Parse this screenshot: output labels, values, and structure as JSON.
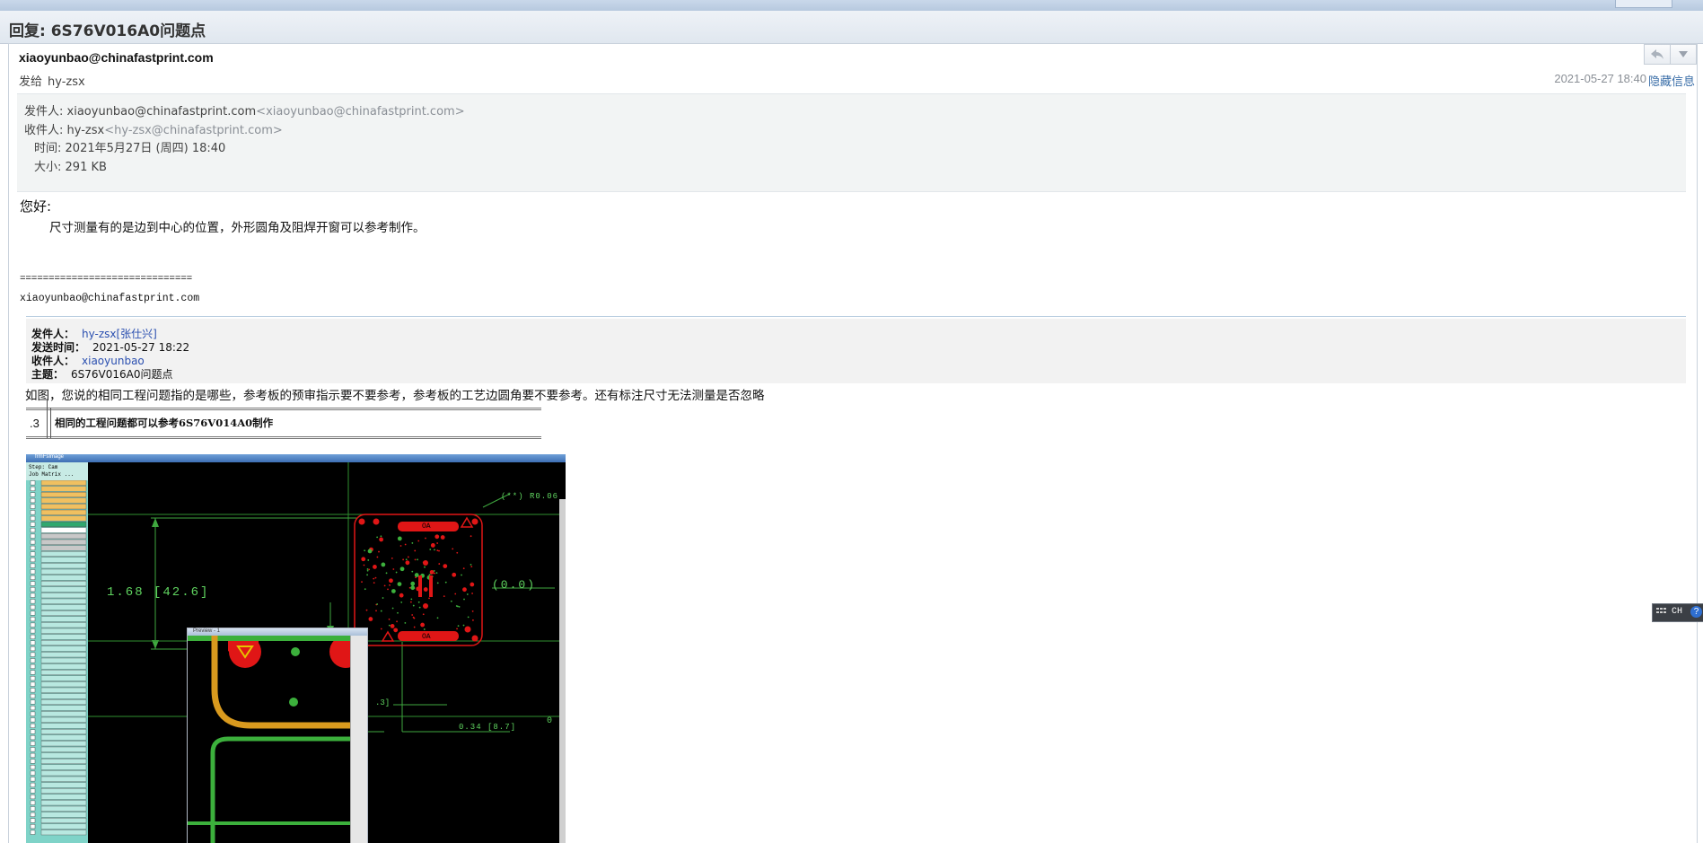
{
  "window": {
    "title": "回复: 6S76V016A0问题点"
  },
  "message": {
    "sender": "xiaoyunbao@chinafastprint.com",
    "to_prefix": "发给",
    "to_name": "hy-zsx",
    "date": "2021-05-27 18:40",
    "hide_label": "隐藏信息",
    "nav": {
      "reply_icon": "reply-icon",
      "more_icon": "chevron-down-icon"
    }
  },
  "header_details": {
    "from_label": "发件人:",
    "from_name": "xiaoyunbao@chinafastprint.com",
    "from_addr": "<xiaoyunbao@chinafastprint.com>",
    "to_label": "收件人:",
    "to_name": "hy-zsx",
    "to_addr": "<hy-zsx@chinafastprint.com>",
    "time_label": "时间:",
    "time_value": "2021年5月27日 (周四) 18:40",
    "size_label": "大小:",
    "size_value": "291 KB"
  },
  "body": {
    "greeting": "您好:",
    "line1": "尺寸测量有的是边到中心的位置，外形圆角及阻焊开窗可以参考制作。",
    "separator": "==============================",
    "signature": "xiaoyunbao@chinafastprint.com"
  },
  "quoted": {
    "from_label": "发件人：",
    "from_value": "hy-zsx[张仕兴]",
    "sent_label": "发送时间：",
    "sent_value": "2021-05-27 18:22",
    "to_label": "收件人：",
    "to_value": "xiaoyunbao",
    "subject_label": "主题：",
    "subject_value": "6S76V016A0问题点",
    "question": "如图，您说的相同工程问题指的是哪些，参考板的预审指示要不要参考，参考板的工艺边圆角要不要参考。还有标注尺寸无法测量是否忽略",
    "table_num": ".3",
    "table_text": "相同的工程问题都可以参考6S76V014A0制作"
  },
  "screenshot": {
    "window_title": "frmFsImage",
    "side_header1": "Step: Cam",
    "side_header2": "Job Matrix ...",
    "dim_label1": "1.68 [42.6]",
    "dim_label2": "(0.0)",
    "dim_label3": "(**) R0.06",
    "dim_label4": "0.34 [8.7]",
    "dim_label5": ".3]",
    "dim_label6": "0",
    "pad_label": "OA",
    "preview_title": "Preview - 1"
  },
  "ime": {
    "label": "CH",
    "help": "?"
  },
  "colors": {
    "accent": "#3a6ea8",
    "link": "#2a4fb0",
    "pcb_red": "#e01616",
    "pcb_green": "#5fd35f"
  }
}
